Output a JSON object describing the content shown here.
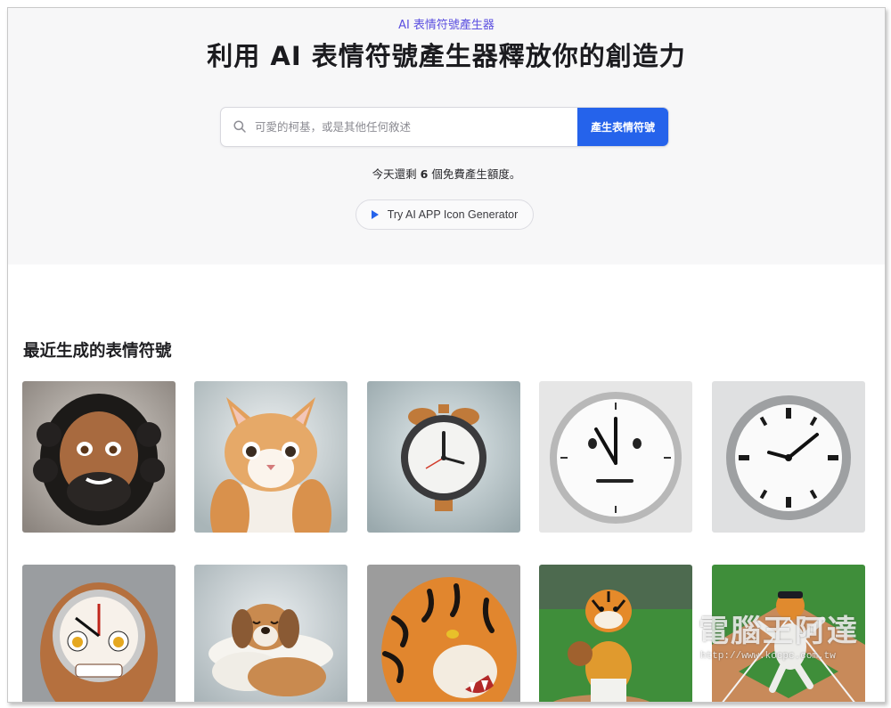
{
  "header": {
    "eyebrow": "AI 表情符號產生器",
    "title": "利用 AI 表情符號產生器釋放你的創造力"
  },
  "search": {
    "placeholder": "可愛的柯基，或是其他任何敘述",
    "value": "",
    "icon": "search-icon",
    "button_label": "產生表情符號"
  },
  "quota": {
    "prefix": "今天還剩",
    "count": "6",
    "suffix": "個免費產生額度。"
  },
  "try_button": {
    "label": "Try AI APP Icon Generator",
    "icon": "play-icon"
  },
  "recent": {
    "title": "最近生成的表情符號",
    "items": [
      {
        "subject": "bearded-man-emoji"
      },
      {
        "subject": "cat-emoji"
      },
      {
        "subject": "alarm-clock-emoji"
      },
      {
        "subject": "clock-face-emoji"
      },
      {
        "subject": "roman-clock-emoji"
      },
      {
        "subject": "clock-head-emoji"
      },
      {
        "subject": "sleeping-dog-emoji"
      },
      {
        "subject": "tiger-emoji"
      },
      {
        "subject": "tiger-baseball-player-emoji"
      },
      {
        "subject": "tiger-pitcher-emoji"
      }
    ]
  },
  "watermark": {
    "text": "電腦王阿達",
    "url": "http://www.kocpc.com.tw"
  },
  "colors": {
    "accent": "#2563eb",
    "eyebrow": "#5b4fe0",
    "hero_bg": "#f7f7f8"
  }
}
